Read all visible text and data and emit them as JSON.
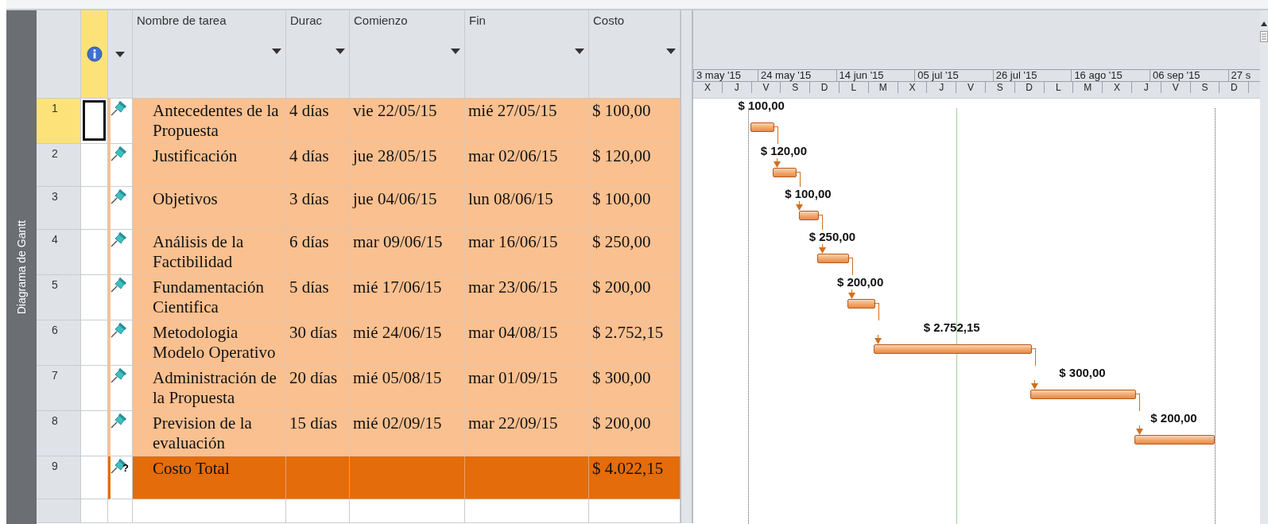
{
  "view_label": "Diagrama de Gantt",
  "columns": [
    "Nombre de tarea",
    "Durac",
    "Comienzo",
    "Fin",
    "Costo"
  ],
  "timescale": {
    "top": [
      "3 may '15",
      "24 may '15",
      "14 jun '15",
      "05 jul '15",
      "26 jul '15",
      "16 ago '15",
      "06 sep '15",
      "27 s"
    ],
    "bottom": [
      "X",
      "J",
      "V",
      "S",
      "D",
      "L",
      "M",
      "X",
      "J",
      "V",
      "S",
      "D",
      "L",
      "M",
      "X",
      "J",
      "V",
      "S",
      "D"
    ]
  },
  "tasks": [
    {
      "id": "1",
      "kind": "task",
      "selected": true,
      "name": "Antecedentes de la Propuesta",
      "duration": "4 días",
      "start": "vie 22/05/15",
      "finish": "mié 27/05/15",
      "cost": "$ 100,00",
      "bar_label": "$ 100,00"
    },
    {
      "id": "2",
      "kind": "task",
      "selected": false,
      "name": "Justificación",
      "duration": "4 días",
      "start": "jue 28/05/15",
      "finish": "mar 02/06/15",
      "cost": "$ 120,00",
      "bar_label": "$ 120,00"
    },
    {
      "id": "3",
      "kind": "task",
      "selected": false,
      "name": "Objetivos",
      "duration": "3 días",
      "start": "jue 04/06/15",
      "finish": "lun 08/06/15",
      "cost": "$ 100,00",
      "bar_label": "$ 100,00"
    },
    {
      "id": "4",
      "kind": "task",
      "selected": false,
      "name": "Análisis de la Factibilidad",
      "duration": "6 días",
      "start": "mar 09/06/15",
      "finish": "mar 16/06/15",
      "cost": "$ 250,00",
      "bar_label": "$ 250,00"
    },
    {
      "id": "5",
      "kind": "task",
      "selected": false,
      "name": "Fundamentación Cientifica",
      "duration": "5 días",
      "start": "mié 17/06/15",
      "finish": "mar 23/06/15",
      "cost": "$ 200,00",
      "bar_label": "$ 200,00"
    },
    {
      "id": "6",
      "kind": "task",
      "selected": false,
      "name": "Metodologia Modelo Operativo",
      "duration": "30 días",
      "start": "mié 24/06/15",
      "finish": "mar 04/08/15",
      "cost": "$ 2.752,15",
      "bar_label": "$ 2.752,15"
    },
    {
      "id": "7",
      "kind": "task",
      "selected": false,
      "name": "Administración de la Propuesta",
      "duration": "20 días",
      "start": "mié 05/08/15",
      "finish": "mar 01/09/15",
      "cost": "$ 300,00",
      "bar_label": "$ 300,00"
    },
    {
      "id": "8",
      "kind": "task",
      "selected": false,
      "name": "Prevision de la evaluación",
      "duration": "15 días",
      "start": "mié 02/09/15",
      "finish": "mar 22/09/15",
      "cost": "$ 200,00",
      "bar_label": "$ 200,00"
    },
    {
      "id": "9",
      "kind": "total",
      "selected": false,
      "name": "Costo Total",
      "cost": "$ 4.022,15",
      "mode_mark": "?"
    }
  ]
}
